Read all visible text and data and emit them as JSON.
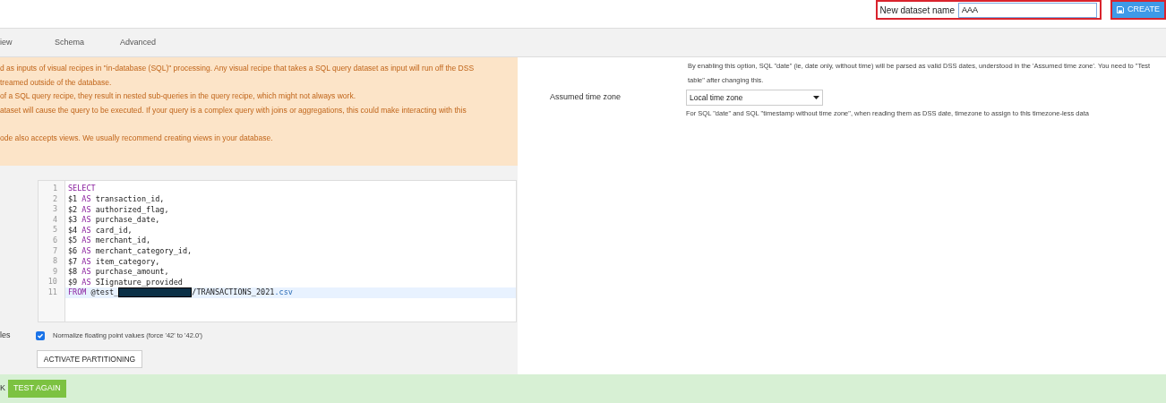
{
  "header": {
    "name_label": "New dataset name",
    "name_value": "AAA",
    "annotated": true,
    "create_button": "CREATE"
  },
  "tabs": [
    {
      "label": "iew",
      "selected": false
    },
    {
      "label": "Schema",
      "selected": false
    },
    {
      "label": "Advanced",
      "selected": false
    }
  ],
  "warning": [
    "d as inputs of visual recipes in \"in-database (SQL)\" processing. Any visual recipe that takes a SQL query dataset as input will run off the DSS",
    "treamed outside of the database.",
    "of a SQL query recipe, they result in nested sub-queries in the query recipe, which might not always work.",
    "ataset will cause the query to be executed. If your query is a complex query with joins or aggregations, this could make interacting with this",
    "ode also accepts views. We usually recommend creating views in your database."
  ],
  "editor": {
    "lines": [
      {
        "number": "1",
        "selected": false,
        "tokens": [
          {
            "kind": "keyword",
            "text": "SELECT"
          }
        ]
      },
      {
        "number": "2",
        "selected": false,
        "tokens": [
          {
            "kind": "plain",
            "text": "$1 "
          },
          {
            "kind": "keyword",
            "text": "AS"
          },
          {
            "kind": "plain",
            "text": " transaction_id,"
          }
        ]
      },
      {
        "number": "3",
        "selected": false,
        "tokens": [
          {
            "kind": "plain",
            "text": "$2 "
          },
          {
            "kind": "keyword",
            "text": "AS"
          },
          {
            "kind": "plain",
            "text": " authorized_flag,"
          }
        ]
      },
      {
        "number": "4",
        "selected": false,
        "tokens": [
          {
            "kind": "plain",
            "text": "$3 "
          },
          {
            "kind": "keyword",
            "text": "AS"
          },
          {
            "kind": "plain",
            "text": " purchase_date,"
          }
        ]
      },
      {
        "number": "5",
        "selected": false,
        "tokens": [
          {
            "kind": "plain",
            "text": "$4 "
          },
          {
            "kind": "keyword",
            "text": "AS"
          },
          {
            "kind": "plain",
            "text": " card_id,"
          }
        ]
      },
      {
        "number": "6",
        "selected": false,
        "tokens": [
          {
            "kind": "plain",
            "text": "$5 "
          },
          {
            "kind": "keyword",
            "text": "AS"
          },
          {
            "kind": "plain",
            "text": " merchant_id,"
          }
        ]
      },
      {
        "number": "7",
        "selected": false,
        "tokens": [
          {
            "kind": "plain",
            "text": "$6 "
          },
          {
            "kind": "keyword",
            "text": "AS"
          },
          {
            "kind": "plain",
            "text": " merchant_category_id,"
          }
        ]
      },
      {
        "number": "8",
        "selected": false,
        "tokens": [
          {
            "kind": "plain",
            "text": "$7 "
          },
          {
            "kind": "keyword",
            "text": "AS"
          },
          {
            "kind": "plain",
            "text": " item_category,"
          }
        ]
      },
      {
        "number": "9",
        "selected": false,
        "tokens": [
          {
            "kind": "plain",
            "text": "$8 "
          },
          {
            "kind": "keyword",
            "text": "AS"
          },
          {
            "kind": "plain",
            "text": " purchase_amount,"
          }
        ]
      },
      {
        "number": "10",
        "selected": false,
        "tokens": [
          {
            "kind": "plain",
            "text": "$9 "
          },
          {
            "kind": "keyword",
            "text": "AS"
          },
          {
            "kind": "plain",
            "text": " SIignature_provided"
          }
        ]
      },
      {
        "number": "11",
        "selected": true,
        "tokens": [
          {
            "kind": "keyword",
            "text": "FROM"
          },
          {
            "kind": "plain",
            "text": " @test_"
          },
          {
            "kind": "redacted"
          },
          {
            "kind": "plain",
            "text": "/TRANSACTIONS_2021"
          },
          {
            "kind": "extension",
            "text": ".csv"
          }
        ]
      }
    ]
  },
  "normalize": {
    "side_label": "les",
    "label": "Normalize floating point values (force '42' to '42.0')",
    "checked": true
  },
  "partition_button": "ACTIVATE PARTITIONING",
  "footer": {
    "status": "K",
    "button": "TEST AGAIN"
  },
  "settings": {
    "date_help": "By enabling this option, SQL \"date\" (ie, date only, without time) will be parsed as valid DSS dates, understood in the 'Assumed time zone'. You need to \"Test table\" after changing this.",
    "timezone_label": "Assumed time zone",
    "timezone_value": "Local time zone",
    "timezone_help": "For SQL \"date\" and SQL \"timestamp without time zone\", when reading them as DSS date, timezone to assign to this timezone-less data"
  }
}
